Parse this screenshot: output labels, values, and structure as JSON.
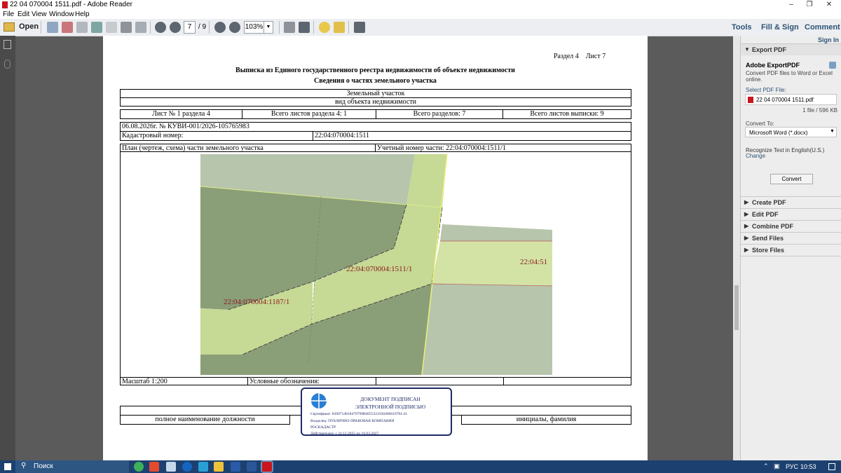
{
  "window": {
    "title": "22 04 070004 1511.pdf - Adobe Reader",
    "minimize_icon": "minimize-icon",
    "maximize_icon": "restore-icon",
    "close_icon": "close-icon"
  },
  "menu": [
    "File",
    "Edit",
    "View",
    "Window",
    "Help"
  ],
  "toolbar": {
    "open_label": "Open",
    "page_current": "7",
    "page_total": "/ 9",
    "zoom": "103%",
    "tools_label": "Tools",
    "fill_sign_label": "Fill & Sign",
    "comment_label": "Comment"
  },
  "document": {
    "header_right": "Раздел 4    Лист 7",
    "title": "Выписка из Единого государственного реестра недвижимости об объекте недвижимости",
    "subtitle": "Сведения о частях земельного участка",
    "object_type": "Земельный участок",
    "object_type_caption": "вид объекта недвижимости",
    "row_sheets": [
      "Лист № 1 раздела 4",
      "Всего листов раздела 4: 1",
      "Всего разделов: 7",
      "Всего листов выписки: 9"
    ],
    "date_number": "06.08.2026г. № КУВИ-001/2026-105765983",
    "cadastral_label": "Кадастровый номер:",
    "cadastral_value": "22:04:070004:1511",
    "plan_label": "План (чертеж, схема) части земельного участка",
    "part_number_label": "Учетный номер части: 22:04:070004:1511/1",
    "map_labels": {
      "main_part": "22:04:070004:1511/1",
      "neighbor": "22:04:070004:1187/1",
      "cut_off": "22:04:51"
    },
    "scale": "Масштаб 1:200",
    "legend_label": "Условные обозначения:",
    "position_caption": "полное наименование должности",
    "initials_caption": "инициалы, фамилия",
    "stamp": {
      "line1": "ДОКУМЕНТ ПОДПИСАН",
      "line2": "ЭЛЕКТРОННОЙ ПОДПИСЬЮ",
      "certificate": "Сертификат: 8399714818479799B0055321930400019784 43",
      "owner": "Владелец: ПУБЛИЧНО-ПРАВОВАЯ КОМПАНИЯ",
      "owner2": "РОСКАДАСТР",
      "valid": "Действителен: с 24.12.2025 по 19.03.2027"
    }
  },
  "right_pane": {
    "sign_in": "Sign In",
    "export_header": "Export PDF",
    "service_title": "Adobe ExportPDF",
    "service_desc": "Convert PDF files to Word or Excel online.",
    "select_file_label": "Select PDF File:",
    "selected_file": "22 04 070004 1511.pdf",
    "file_count": "1 file / 596 KB",
    "convert_to_label": "Convert To:",
    "convert_to_value": "Microsoft Word (*.docx)",
    "recognize_text": "Recognize Text in English(U.S.)",
    "change_link": "Change",
    "convert_button": "Convert",
    "sections": [
      "Create PDF",
      "Edit PDF",
      "Combine PDF",
      "Send Files",
      "Store Files"
    ]
  },
  "taskbar": {
    "search_placeholder": "Поиск",
    "language": "РУС",
    "time": "10:53"
  },
  "colors": {
    "toolbar_bg": "#eceef1",
    "tab_text": "#2d5276",
    "taskbar": "#1c4170",
    "map_dark_green": "#8a9e78",
    "map_light_green": "#c6d995",
    "map_grey_green": "#b7c5ac",
    "parcel_label": "#8b1a1a",
    "stamp_border": "#1f2a66"
  }
}
